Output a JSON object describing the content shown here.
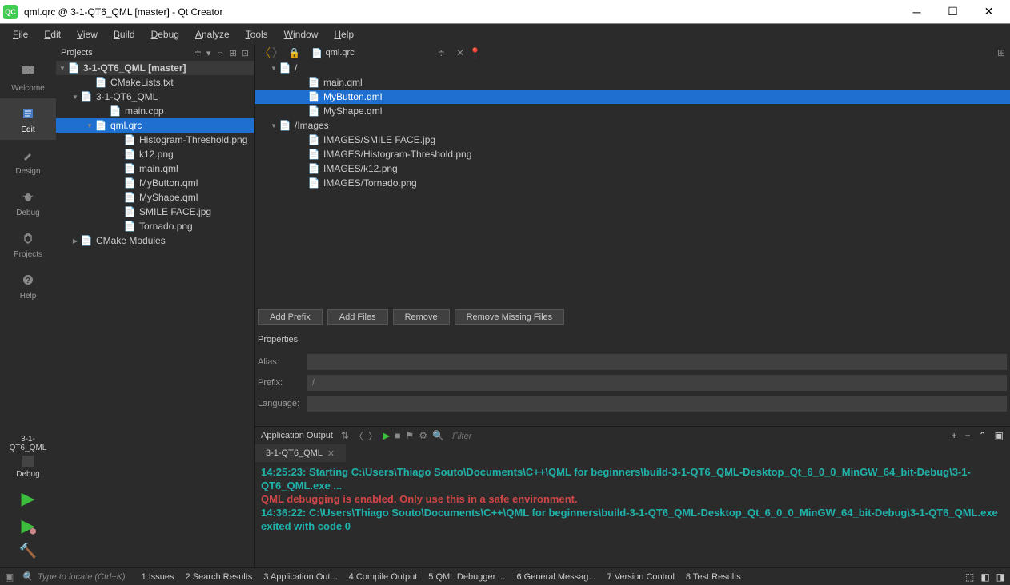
{
  "titlebar": {
    "text": "qml.qrc @ 3-1-QT6_QML [master] - Qt Creator"
  },
  "menubar": [
    "File",
    "Edit",
    "View",
    "Build",
    "Debug",
    "Analyze",
    "Tools",
    "Window",
    "Help"
  ],
  "sidebar": {
    "items": [
      {
        "label": "Welcome"
      },
      {
        "label": "Edit"
      },
      {
        "label": "Design"
      },
      {
        "label": "Debug"
      },
      {
        "label": "Projects"
      },
      {
        "label": "Help"
      }
    ],
    "kit": "3-1-QT6_QML",
    "config": "Debug"
  },
  "projectsPanel": {
    "title": "Projects"
  },
  "projectTree": [
    {
      "label": "3-1-QT6_QML [master]",
      "indent": 0,
      "arrow": "▼",
      "root": true
    },
    {
      "label": "CMakeLists.txt",
      "indent": 2,
      "arrow": ""
    },
    {
      "label": "3-1-QT6_QML",
      "indent": 1,
      "arrow": "▼"
    },
    {
      "label": "main.cpp",
      "indent": 3,
      "arrow": ""
    },
    {
      "label": "qml.qrc",
      "indent": 2,
      "arrow": "▼",
      "selected": true
    },
    {
      "label": "Histogram-Threshold.png",
      "indent": 4,
      "arrow": ""
    },
    {
      "label": "k12.png",
      "indent": 4,
      "arrow": ""
    },
    {
      "label": "main.qml",
      "indent": 4,
      "arrow": ""
    },
    {
      "label": "MyButton.qml",
      "indent": 4,
      "arrow": ""
    },
    {
      "label": "MyShape.qml",
      "indent": 4,
      "arrow": ""
    },
    {
      "label": "SMILE FACE.jpg",
      "indent": 4,
      "arrow": ""
    },
    {
      "label": "Tornado.png",
      "indent": 4,
      "arrow": ""
    },
    {
      "label": "CMake Modules",
      "indent": 1,
      "arrow": "▶"
    }
  ],
  "editor": {
    "currentFile": "qml.qrc"
  },
  "resources": [
    {
      "label": "/",
      "indent": 1,
      "arrow": "▼"
    },
    {
      "label": "main.qml",
      "indent": 3,
      "arrow": ""
    },
    {
      "label": "MyButton.qml",
      "indent": 3,
      "arrow": "",
      "selected": true
    },
    {
      "label": "MyShape.qml",
      "indent": 3,
      "arrow": ""
    },
    {
      "label": "/Images",
      "indent": 1,
      "arrow": "▼"
    },
    {
      "label": "IMAGES/SMILE FACE.jpg",
      "indent": 3,
      "arrow": ""
    },
    {
      "label": "IMAGES/Histogram-Threshold.png",
      "indent": 3,
      "arrow": ""
    },
    {
      "label": "IMAGES/k12.png",
      "indent": 3,
      "arrow": ""
    },
    {
      "label": "IMAGES/Tornado.png",
      "indent": 3,
      "arrow": ""
    }
  ],
  "resourceButtons": [
    "Add Prefix",
    "Add Files",
    "Remove",
    "Remove Missing Files"
  ],
  "properties": {
    "title": "Properties",
    "alias": {
      "label": "Alias:",
      "value": ""
    },
    "prefix": {
      "label": "Prefix:",
      "value": "/"
    },
    "language": {
      "label": "Language:",
      "value": ""
    }
  },
  "output": {
    "title": "Application Output",
    "filterPlaceholder": "Filter",
    "tab": "3-1-QT6_QML",
    "lines": [
      {
        "cls": "console-teal",
        "text": "14:25:23: Starting C:\\Users\\Thiago Souto\\Documents\\C++\\QML for beginners\\build-3-1-QT6_QML-Desktop_Qt_6_0_0_MinGW_64_bit-Debug\\3-1-QT6_QML.exe ..."
      },
      {
        "cls": "console-red",
        "text": "QML debugging is enabled. Only use this in a safe environment."
      },
      {
        "cls": "console-teal",
        "text": "14:36:22: C:\\Users\\Thiago Souto\\Documents\\C++\\QML for beginners\\build-3-1-QT6_QML-Desktop_Qt_6_0_0_MinGW_64_bit-Debug\\3-1-QT6_QML.exe exited with code 0"
      }
    ]
  },
  "statusbar": {
    "locate": "Type to locate (Ctrl+K)",
    "tabs": [
      "1   Issues",
      "2   Search Results",
      "3   Application Out...",
      "4   Compile Output",
      "5   QML Debugger ...",
      "6   General Messag...",
      "7   Version Control",
      "8   Test Results"
    ]
  }
}
